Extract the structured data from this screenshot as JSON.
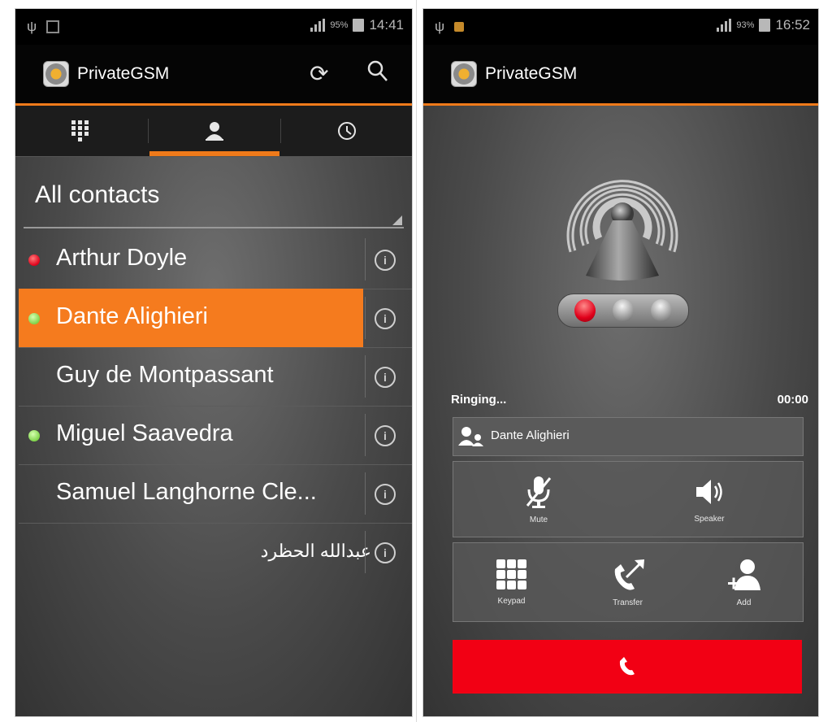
{
  "colors": {
    "accent": "#ef7a1a",
    "online": "#7fd34a",
    "busy": "#e0001a",
    "end_call": "#f20014"
  },
  "screen1": {
    "status": {
      "battery_percent": "95%",
      "time": "14:41"
    },
    "app_title": "PrivateGSM",
    "action_icons": [
      "sync-icon",
      "search-icon"
    ],
    "tabs": [
      {
        "icon": "dialpad-icon",
        "selected": false
      },
      {
        "icon": "contacts-icon",
        "selected": true
      },
      {
        "icon": "history-clock-icon",
        "selected": false
      }
    ],
    "filter": {
      "label": "All contacts"
    },
    "contacts": [
      {
        "name": "Arthur Doyle",
        "status": "busy",
        "selected": false
      },
      {
        "name": "Dante Alighieri",
        "status": "online",
        "selected": true
      },
      {
        "name": "Guy de Montpassant",
        "status": "none",
        "selected": false
      },
      {
        "name": "Miguel Saavedra",
        "status": "online",
        "selected": false
      },
      {
        "name": "Samuel Langhorne Cle...",
        "status": "none",
        "selected": false
      },
      {
        "name": "عبدالله الحظرد",
        "status": "none",
        "selected": false
      }
    ]
  },
  "screen2": {
    "status": {
      "battery_percent": "93%",
      "time": "16:52"
    },
    "app_title": "PrivateGSM",
    "call": {
      "state": "Ringing...",
      "timer": "00:00",
      "caller": "Dante Alighieri"
    },
    "controls": {
      "mute": "Mute",
      "speaker": "Speaker",
      "keypad": "Keypad",
      "transfer": "Transfer",
      "add": "Add"
    }
  }
}
